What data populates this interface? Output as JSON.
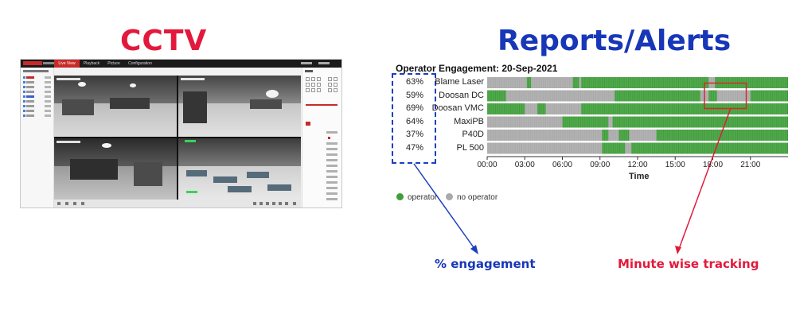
{
  "headings": {
    "cctv": "CCTV",
    "reports": "Reports/Alerts"
  },
  "nvr": {
    "nav": [
      "Live View",
      "Playback",
      "Picture",
      "Configuration"
    ]
  },
  "chart_data": {
    "type": "heatmap",
    "title": "Operator Engagement: 20-Sep-2021",
    "xlabel": "Time",
    "ylabel": "",
    "x_ticks": [
      "00:00",
      "03:00",
      "06:00",
      "09:00",
      "12:00",
      "15:00",
      "18:00",
      "21:00"
    ],
    "x_range": [
      "00:00",
      "24:00"
    ],
    "resolution": "minute",
    "rows": [
      {
        "machine": "Blame Laser",
        "engagement": "63%",
        "operator_intervals": [
          [
            "03:10",
            "03:30"
          ],
          [
            "06:50",
            "07:20"
          ],
          [
            "07:30",
            "17:40"
          ],
          [
            "18:10",
            "24:00"
          ]
        ]
      },
      {
        "machine": "Doosan DC",
        "engagement": "59%",
        "operator_intervals": [
          [
            "00:00",
            "01:30"
          ],
          [
            "10:10",
            "17:00"
          ],
          [
            "17:40",
            "18:20"
          ],
          [
            "21:00",
            "24:00"
          ]
        ]
      },
      {
        "machine": "Doosan VMC",
        "engagement": "69%",
        "operator_intervals": [
          [
            "00:00",
            "03:00"
          ],
          [
            "04:00",
            "04:40"
          ],
          [
            "07:30",
            "24:00"
          ]
        ]
      },
      {
        "machine": "MaxiPB",
        "engagement": "64%",
        "operator_intervals": [
          [
            "06:00",
            "09:40"
          ],
          [
            "10:00",
            "24:00"
          ]
        ]
      },
      {
        "machine": "P40D",
        "engagement": "37%",
        "operator_intervals": [
          [
            "09:10",
            "09:40"
          ],
          [
            "10:30",
            "11:20"
          ],
          [
            "13:30",
            "24:00"
          ]
        ]
      },
      {
        "machine": "PL 500",
        "engagement": "47%",
        "operator_intervals": [
          [
            "09:10",
            "11:00"
          ],
          [
            "11:30",
            "24:00"
          ]
        ]
      }
    ],
    "legend": [
      {
        "label": "operator",
        "color": "#3f9e3a"
      },
      {
        "label": "no operator",
        "color": "#a9a9a9"
      }
    ],
    "highlight": {
      "row": "Doosan DC",
      "from": "17:20",
      "to": "20:40",
      "color": "#d62a2a"
    },
    "legend_placement": "bottom-left"
  },
  "annotations": {
    "engagement": "% engagement",
    "minute": "Minute wise tracking"
  }
}
